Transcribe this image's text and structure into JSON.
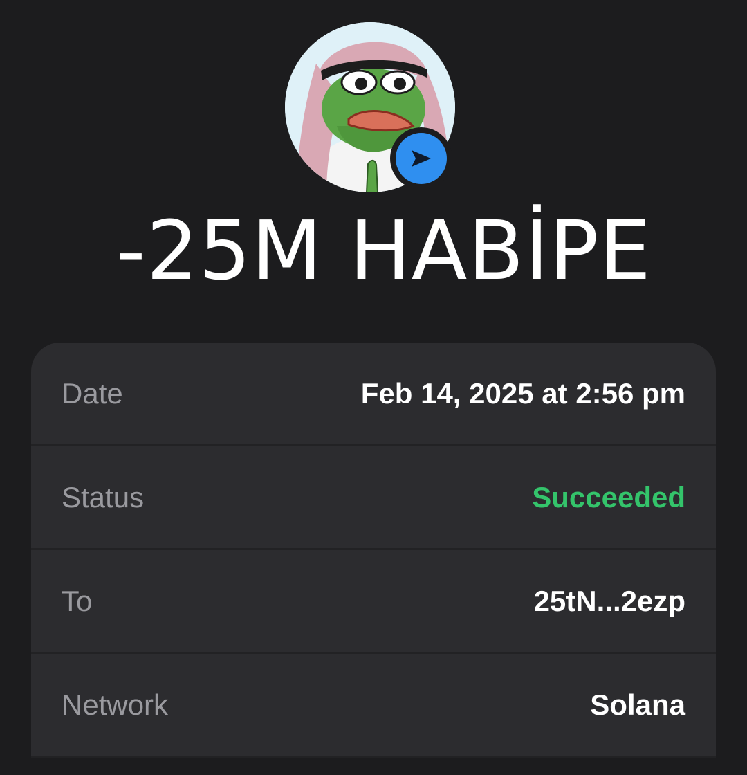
{
  "header": {
    "avatar_icon": "pepe-avatar",
    "badge_icon": "send-arrow-icon",
    "badge_color": "#2f8ff0"
  },
  "amount": {
    "value": "-25M",
    "token": "HABİPE"
  },
  "details": [
    {
      "label": "Date",
      "value": "Feb 14, 2025 at 2:56 pm"
    },
    {
      "label": "Status",
      "value": "Succeeded",
      "value_color": "#34c46b"
    },
    {
      "label": "To",
      "value": "25tN...2ezp"
    },
    {
      "label": "Network",
      "value": "Solana"
    }
  ]
}
